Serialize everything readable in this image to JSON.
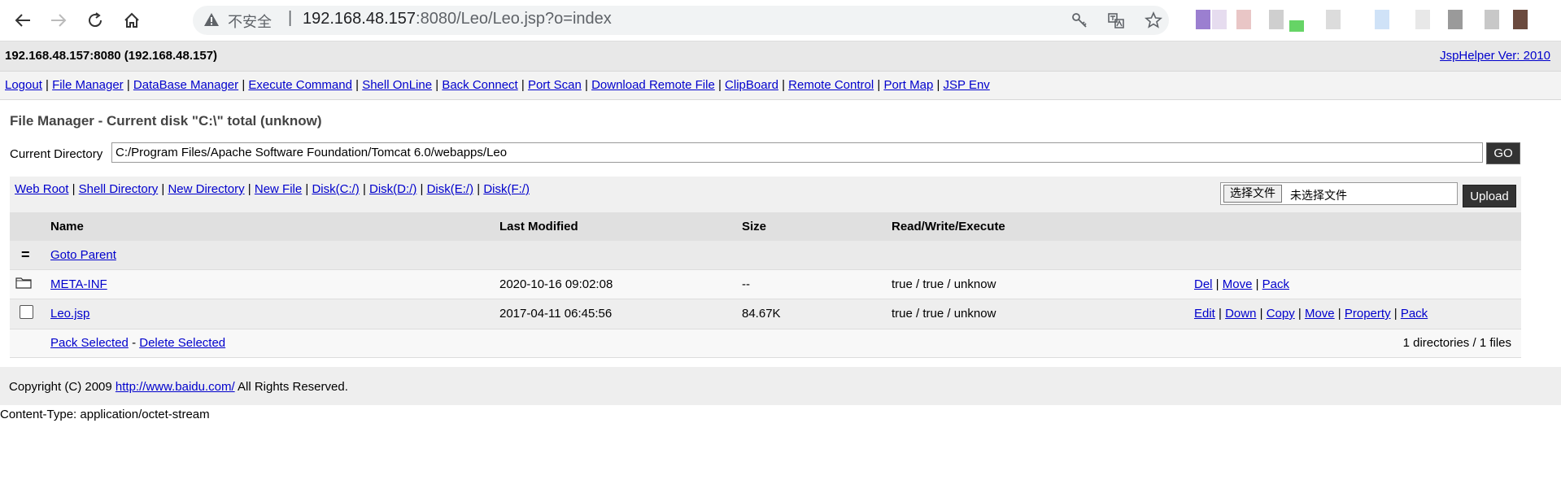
{
  "browser": {
    "insecure_label": "不安全",
    "separator": "|",
    "url_host": "192.168.48.157",
    "url_rest": ":8080/Leo/Leo.jsp?o=index"
  },
  "header": {
    "server": "192.168.48.157:8080 (192.168.48.157)",
    "version_link": "JspHelper Ver: 2010"
  },
  "menu": [
    {
      "label": "Logout"
    },
    {
      "label": "File Manager"
    },
    {
      "label": "DataBase Manager"
    },
    {
      "label": "Execute Command"
    },
    {
      "label": "Shell OnLine"
    },
    {
      "label": "Back Connect"
    },
    {
      "label": "Port Scan"
    },
    {
      "label": "Download Remote File"
    },
    {
      "label": "ClipBoard"
    },
    {
      "label": "Remote Control"
    },
    {
      "label": "Port Map"
    },
    {
      "label": "JSP Env"
    }
  ],
  "file_manager": {
    "title": "File Manager - Current disk \"C:\\\" total (unknow)",
    "current_dir_label": "Current Directory",
    "current_dir_value": "C:/Program Files/Apache Software Foundation/Tomcat 6.0/webapps/Leo",
    "go_label": "GO",
    "toolbar_links": [
      {
        "label": "Web Root"
      },
      {
        "label": "Shell Directory"
      },
      {
        "label": "New Directory"
      },
      {
        "label": "New File"
      },
      {
        "label": "Disk(C:/)"
      },
      {
        "label": "Disk(D:/)"
      },
      {
        "label": "Disk(E:/)"
      },
      {
        "label": "Disk(F:/)"
      }
    ],
    "choose_file_label": "选择文件",
    "no_file_label": "未选择文件",
    "upload_label": "Upload",
    "columns": {
      "name": "Name",
      "modified": "Last Modified",
      "size": "Size",
      "rwx": "Read/Write/Execute"
    },
    "parent_icon": "=",
    "parent_label": "Goto Parent",
    "rows": [
      {
        "type": "dir",
        "icon": "folder-icon",
        "name": "META-INF",
        "modified": "2020-10-16 09:02:08",
        "size": "--",
        "rwx": "true / true / unknow",
        "actions": [
          "Del",
          "Move",
          "Pack"
        ]
      },
      {
        "type": "file",
        "icon": "checkbox",
        "name": "Leo.jsp",
        "modified": "2017-04-11 06:45:56",
        "size": "84.67K",
        "rwx": "true / true / unknow",
        "actions": [
          "Edit",
          "Down",
          "Copy",
          "Move",
          "Property",
          "Pack"
        ]
      }
    ],
    "pack_selected": "Pack Selected",
    "dash": "-",
    "delete_selected": "Delete Selected",
    "summary": "1 directories / 1 files"
  },
  "footer": {
    "copyright_prefix": "Copyright (C) 2009 ",
    "copyright_link": "http://www.baidu.com/",
    "copyright_suffix": " All Rights Reserved.",
    "content_type": "Content-Type: application/octet-stream"
  }
}
